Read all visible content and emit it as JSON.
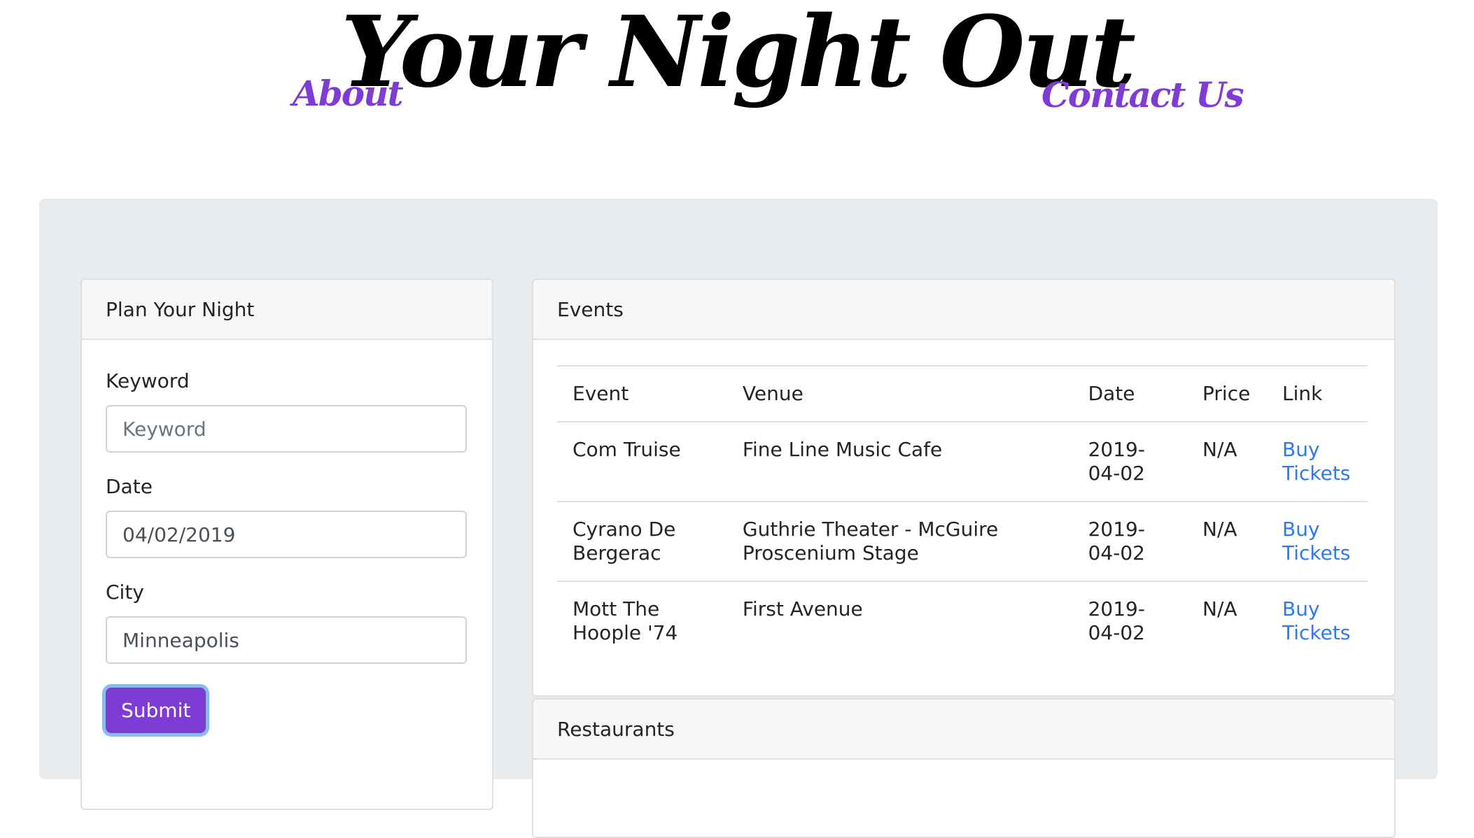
{
  "header": {
    "title": "Your Night Out",
    "nav": {
      "about": "About",
      "contact": "Contact Us"
    },
    "accent_color": "#7e3bd6"
  },
  "plan": {
    "title": "Plan Your Night",
    "keyword": {
      "label": "Keyword",
      "placeholder": "Keyword",
      "value": ""
    },
    "date": {
      "label": "Date",
      "value": "04/02/2019"
    },
    "city": {
      "label": "City",
      "value": "Minneapolis"
    },
    "submit_label": "Submit"
  },
  "events": {
    "title": "Events",
    "columns": [
      "Event",
      "Venue",
      "Date",
      "Price",
      "Link"
    ],
    "rows": [
      {
        "event": "Com Truise",
        "venue": "Fine Line Music Cafe",
        "date": "2019-04-02",
        "price": "N/A",
        "link": "Buy Tickets"
      },
      {
        "event": "Cyrano De Bergerac",
        "venue": "Guthrie Theater - McGuire Proscenium Stage",
        "date": "2019-04-02",
        "price": "N/A",
        "link": "Buy Tickets"
      },
      {
        "event": "Mott The Hoople '74",
        "venue": "First Avenue",
        "date": "2019-04-02",
        "price": "N/A",
        "link": "Buy Tickets"
      }
    ]
  },
  "restaurants": {
    "title": "Restaurants"
  }
}
